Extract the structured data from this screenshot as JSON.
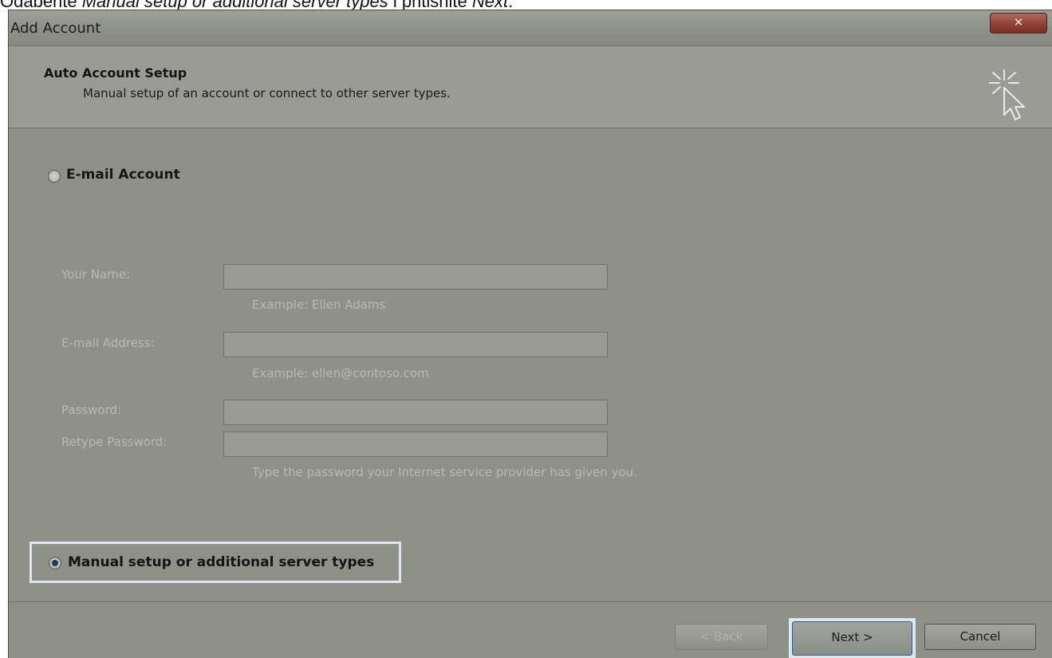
{
  "caption": {
    "prefix": "Odaberite ",
    "emphasis": "Manual setup or additional server types",
    "middle": " i pritisnite ",
    "emphasis2": "Next",
    "suffix": "."
  },
  "window": {
    "title": "Add Account",
    "close_glyph": "✕"
  },
  "header": {
    "title": "Auto Account Setup",
    "subtitle": "Manual setup of an account or connect to other server types."
  },
  "email_option": {
    "label": "E-mail Account",
    "selected": false
  },
  "form": {
    "name_label": "Your Name:",
    "name_value": "",
    "name_example": "Example: Ellen Adams",
    "email_label": "E-mail Address:",
    "email_value": "",
    "email_example": "Example: ellen@contoso.com",
    "password_label": "Password:",
    "retype_label": "Retype Password:",
    "password_hint": "Type the password your Internet service provider has given you."
  },
  "manual_option": {
    "label": "Manual setup or additional server types",
    "selected": true
  },
  "footer": {
    "back_label": "< Back",
    "next_label": "Next >",
    "cancel_label": "Cancel"
  },
  "icons": {
    "header_icon": "cursor-sparkle-icon",
    "close_icon": "close-icon"
  },
  "colors": {
    "dialog_bg": "#8f9189",
    "highlight": "#dde9ee",
    "close_red": "#8f3d31"
  }
}
